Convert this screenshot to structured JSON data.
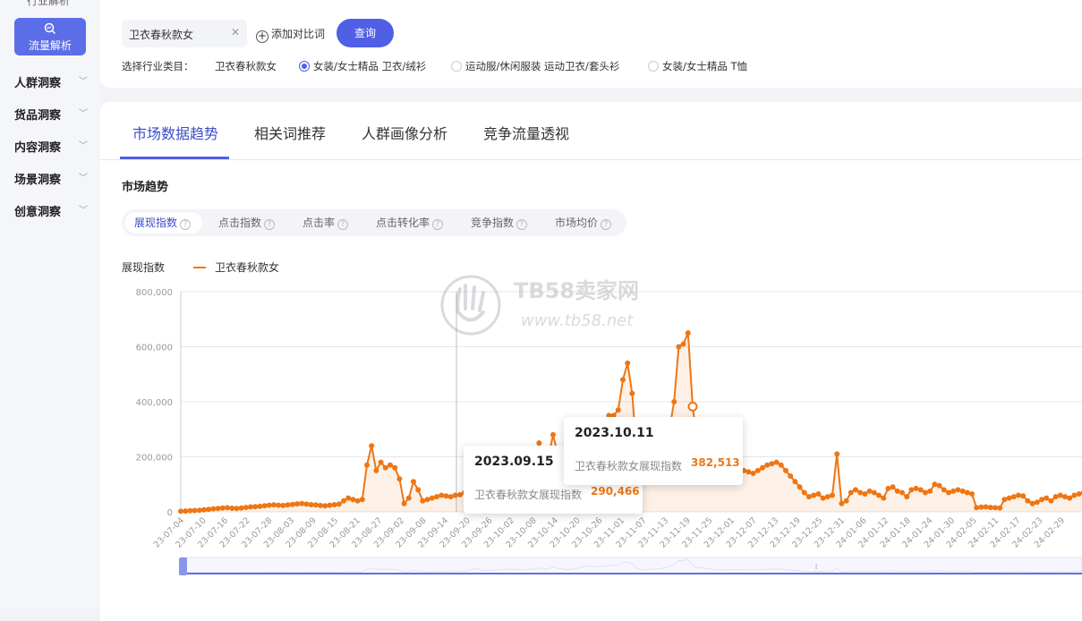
{
  "sidebar": {
    "cut_label": "行业解析",
    "active": "流量解析",
    "items": [
      "人群洞察",
      "货品洞察",
      "内容洞察",
      "场景洞察",
      "创意洞察"
    ]
  },
  "search": {
    "keyword": "卫衣春秋款女",
    "add_compare": "添加对比词",
    "query_btn": "查询"
  },
  "category": {
    "label": "选择行业类目：",
    "keyword": "卫衣春秋款女",
    "options": [
      {
        "text": "女装/女士精品 卫衣/绒衫",
        "selected": true
      },
      {
        "text": "运动服/休闲服装 运动卫衣/套头衫",
        "selected": false
      },
      {
        "text": "女装/女士精品 T恤",
        "selected": false
      }
    ]
  },
  "tabs": [
    "市场数据趋势",
    "相关词推荐",
    "人群画像分析",
    "竞争流量透视"
  ],
  "active_tab": "市场数据趋势",
  "section_title": "市场趋势",
  "metrics": [
    "展现指数",
    "点击指数",
    "点击率",
    "点击转化率",
    "竞争指数",
    "市场均价"
  ],
  "active_metric": "展现指数",
  "colors": {
    "accent": "#4f5fe6",
    "series": "#ee7614"
  },
  "watermark": {
    "name": "TB58卖家网",
    "url": "www.tb58.net"
  },
  "tooltips": [
    {
      "date": "2023.09.15",
      "series": "卫衣春秋款女展现指数",
      "value": "290,466"
    },
    {
      "date": "2023.10.11",
      "series": "卫衣春秋款女展现指数",
      "value": "382,513"
    }
  ],
  "chart_data": {
    "type": "line",
    "title": "",
    "ylabel": "展现指数",
    "legend": [
      "卫衣春秋款女"
    ],
    "ylim": [
      0,
      800000
    ],
    "yticks": [
      "0",
      "200,000",
      "400,000",
      "600,000",
      "800,000"
    ],
    "xticks": [
      "23-07-04",
      "23-07-10",
      "23-07-16",
      "23-07-22",
      "23-07-28",
      "23-08-03",
      "23-08-09",
      "23-08-15",
      "23-08-21",
      "23-08-27",
      "23-09-02",
      "23-09-08",
      "23-09-14",
      "23-09-20",
      "23-09-26",
      "23-10-02",
      "23-10-08",
      "23-10-14",
      "23-10-20",
      "23-10-26",
      "23-11-01",
      "23-11-07",
      "23-11-13",
      "23-11-19",
      "23-11-25",
      "23-12-01",
      "23-12-07",
      "23-12-13",
      "23-12-19",
      "23-12-25",
      "23-12-31",
      "24-01-06",
      "24-01-12",
      "24-01-18",
      "24-01-24",
      "24-01-30",
      "24-02-05",
      "24-02-11",
      "24-02-17",
      "24-02-23",
      "24-02-29"
    ],
    "series": [
      {
        "name": "卫衣春秋款女",
        "values": [
          2000,
          3000,
          4000,
          5000,
          6000,
          7000,
          9000,
          11000,
          12000,
          14000,
          15000,
          13000,
          12000,
          14000,
          16000,
          18000,
          19000,
          20000,
          22000,
          24000,
          25000,
          24000,
          23000,
          25000,
          27000,
          29000,
          30000,
          28000,
          26000,
          25000,
          23000,
          22000,
          24000,
          26000,
          28000,
          40000,
          50000,
          45000,
          40000,
          45000,
          170000,
          240000,
          150000,
          180000,
          160000,
          170000,
          160000,
          120000,
          30000,
          50000,
          110000,
          80000,
          40000,
          45000,
          50000,
          55000,
          60000,
          58000,
          55000,
          60000,
          62000,
          70000,
          120000,
          200000,
          180000,
          105000,
          110000,
          120000,
          150000,
          160000,
          165000,
          170000,
          165000,
          150000,
          160000,
          170000,
          180000,
          250000,
          170000,
          200000,
          280000,
          210000,
          180000,
          150000,
          160000,
          200000,
          290466,
          310000,
          330000,
          300000,
          320000,
          330000,
          350000,
          350000,
          370000,
          480000,
          540000,
          430000,
          200000,
          150000,
          150000,
          170000,
          180000,
          200000,
          250000,
          300000,
          400000,
          600000,
          610000,
          650000,
          382513,
          250000,
          250000,
          200000,
          180000,
          150000,
          130000,
          140000,
          150000,
          160000,
          155000,
          150000,
          145000,
          140000,
          150000,
          160000,
          170000,
          175000,
          180000,
          170000,
          150000,
          130000,
          110000,
          90000,
          70000,
          55000,
          60000,
          65000,
          50000,
          55000,
          60000,
          210000,
          30000,
          40000,
          70000,
          80000,
          70000,
          65000,
          75000,
          70000,
          60000,
          50000,
          85000,
          90000,
          75000,
          70000,
          55000,
          80000,
          85000,
          80000,
          70000,
          75000,
          100000,
          95000,
          80000,
          70000,
          75000,
          80000,
          75000,
          70000,
          65000,
          15000,
          17000,
          18000,
          16000,
          15000,
          14000,
          45000,
          50000,
          55000,
          60000,
          58000,
          40000,
          30000,
          35000,
          45000,
          50000,
          40000,
          55000,
          60000,
          55000,
          50000,
          60000,
          65000,
          70000,
          75000,
          80000,
          85000,
          90000,
          95000,
          90000,
          60000,
          85000,
          90000,
          90000,
          80000,
          70000,
          55000,
          60000,
          70000,
          75000,
          70000,
          65000,
          55000,
          70000,
          130000,
          90000,
          60000,
          55000,
          50000,
          45000,
          40000,
          35000,
          30000,
          25000,
          22000,
          20000,
          18000,
          16000,
          30000,
          40000,
          50000,
          60000,
          80000,
          90000,
          110000,
          140000,
          170000,
          200000,
          200000,
          195000,
          180000,
          150000,
          165000,
          140000,
          120000
        ]
      }
    ]
  }
}
